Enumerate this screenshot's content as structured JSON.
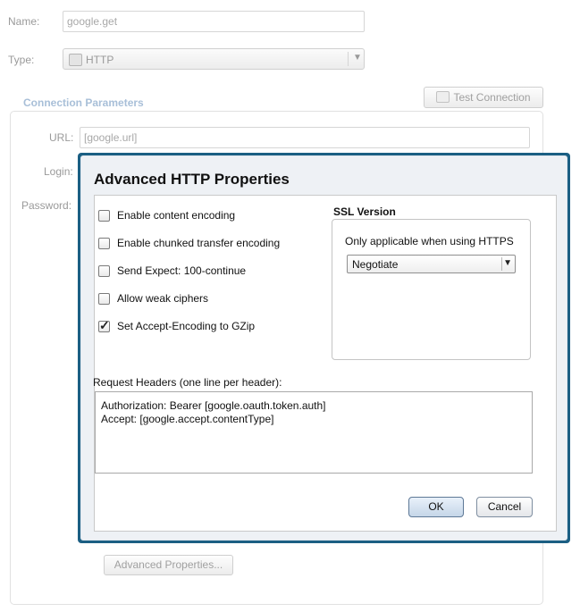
{
  "form": {
    "name_label": "Name:",
    "name_value": "google.get",
    "type_label": "Type:",
    "type_value": "HTTP",
    "connection_section": "Connection Parameters",
    "test_connection": "Test Connection",
    "url_label": "URL:",
    "url_value": "[google.url]",
    "login_label": "Login:",
    "password_label": "Password:",
    "advanced_properties_button": "Advanced Properties..."
  },
  "dialog": {
    "title": "Advanced HTTP Properties",
    "options": [
      {
        "label": "Enable content encoding",
        "checked": false
      },
      {
        "label": "Enable chunked transfer encoding",
        "checked": false
      },
      {
        "label": "Send Expect: 100-continue",
        "checked": false
      },
      {
        "label": "Allow weak ciphers",
        "checked": false
      },
      {
        "label": "Set Accept-Encoding to GZip",
        "checked": true
      }
    ],
    "ssl": {
      "title": "SSL Version",
      "note": "Only applicable when using HTTPS",
      "selected": "Negotiate"
    },
    "headers_label": "Request Headers (one line per header):",
    "headers_lines": [
      "Authorization: Bearer [google.oauth.token.auth]",
      "Accept: [google.accept.contentType]"
    ],
    "ok": "OK",
    "cancel": "Cancel"
  }
}
